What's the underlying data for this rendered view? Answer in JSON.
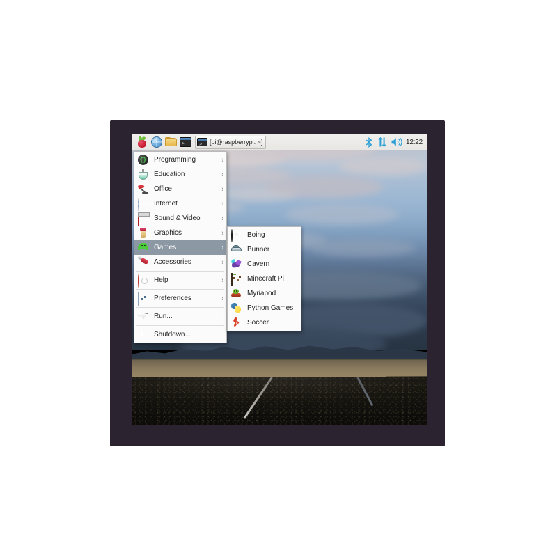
{
  "taskbar": {
    "launchers": [
      {
        "name": "raspberry-menu-button",
        "icon": "raspberry-pi-icon",
        "label": "Menu"
      },
      {
        "name": "web-browser-button",
        "icon": "globe-icon",
        "label": "Web Browser"
      },
      {
        "name": "file-manager-button",
        "icon": "folder-icon",
        "label": "File Manager"
      },
      {
        "name": "terminal-button",
        "icon": "terminal-icon",
        "label": "Terminal"
      }
    ],
    "window_button": {
      "icon": "terminal-icon",
      "title": "[pi@raspberrypi: ~]"
    },
    "tray": {
      "bluetooth_icon": "bluetooth-icon",
      "network_icon": "network-updown-icon",
      "volume_icon": "volume-speaker-icon",
      "clock": "12:22"
    }
  },
  "main_menu": {
    "items": [
      {
        "label": "Programming",
        "icon": "programming-icon",
        "arrow": "›",
        "has_submenu": true,
        "active": false,
        "separator_before": false
      },
      {
        "label": "Education",
        "icon": "education-icon",
        "arrow": "›",
        "has_submenu": true,
        "active": false,
        "separator_before": false
      },
      {
        "label": "Office",
        "icon": "office-icon",
        "arrow": "›",
        "has_submenu": true,
        "active": false,
        "separator_before": false
      },
      {
        "label": "Internet",
        "icon": "internet-icon",
        "arrow": "›",
        "has_submenu": true,
        "active": false,
        "separator_before": false
      },
      {
        "label": "Sound & Video",
        "icon": "sound-video-icon",
        "arrow": "›",
        "has_submenu": true,
        "active": false,
        "separator_before": false
      },
      {
        "label": "Graphics",
        "icon": "graphics-icon",
        "arrow": "›",
        "has_submenu": true,
        "active": false,
        "separator_before": false
      },
      {
        "label": "Games",
        "icon": "games-icon",
        "arrow": "›",
        "has_submenu": true,
        "active": true,
        "separator_before": false
      },
      {
        "label": "Accessories",
        "icon": "accessories-icon",
        "arrow": "›",
        "has_submenu": true,
        "active": false,
        "separator_before": false
      },
      {
        "label": "Help",
        "icon": "help-icon",
        "arrow": "›",
        "has_submenu": true,
        "active": false,
        "separator_before": true
      },
      {
        "label": "Preferences",
        "icon": "preferences-icon",
        "arrow": "›",
        "has_submenu": true,
        "active": false,
        "separator_before": true
      },
      {
        "label": "Run...",
        "icon": "run-icon",
        "arrow": "",
        "has_submenu": false,
        "active": false,
        "separator_before": true
      },
      {
        "label": "Shutdown...",
        "icon": "shutdown-icon",
        "arrow": "",
        "has_submenu": false,
        "active": false,
        "separator_before": true
      }
    ]
  },
  "games_submenu": {
    "items": [
      {
        "label": "Boing",
        "icon": "boing-icon"
      },
      {
        "label": "Bunner",
        "icon": "bunner-icon"
      },
      {
        "label": "Cavern",
        "icon": "cavern-icon"
      },
      {
        "label": "Minecraft Pi",
        "icon": "minecraft-pi-icon"
      },
      {
        "label": "Myriapod",
        "icon": "myriapod-icon"
      },
      {
        "label": "Python Games",
        "icon": "python-icon"
      },
      {
        "label": "Soccer",
        "icon": "soccer-icon"
      }
    ]
  },
  "desktop": {
    "wallpaper_description": "road-through-plains-at-dusk"
  },
  "colors": {
    "taskbar_bg": "#ebeae7",
    "menu_bg": "#fbfbfb",
    "menu_highlight": "#8c99a4",
    "bezel": "#2b2430",
    "accent_blue": "#2a9fd6"
  }
}
